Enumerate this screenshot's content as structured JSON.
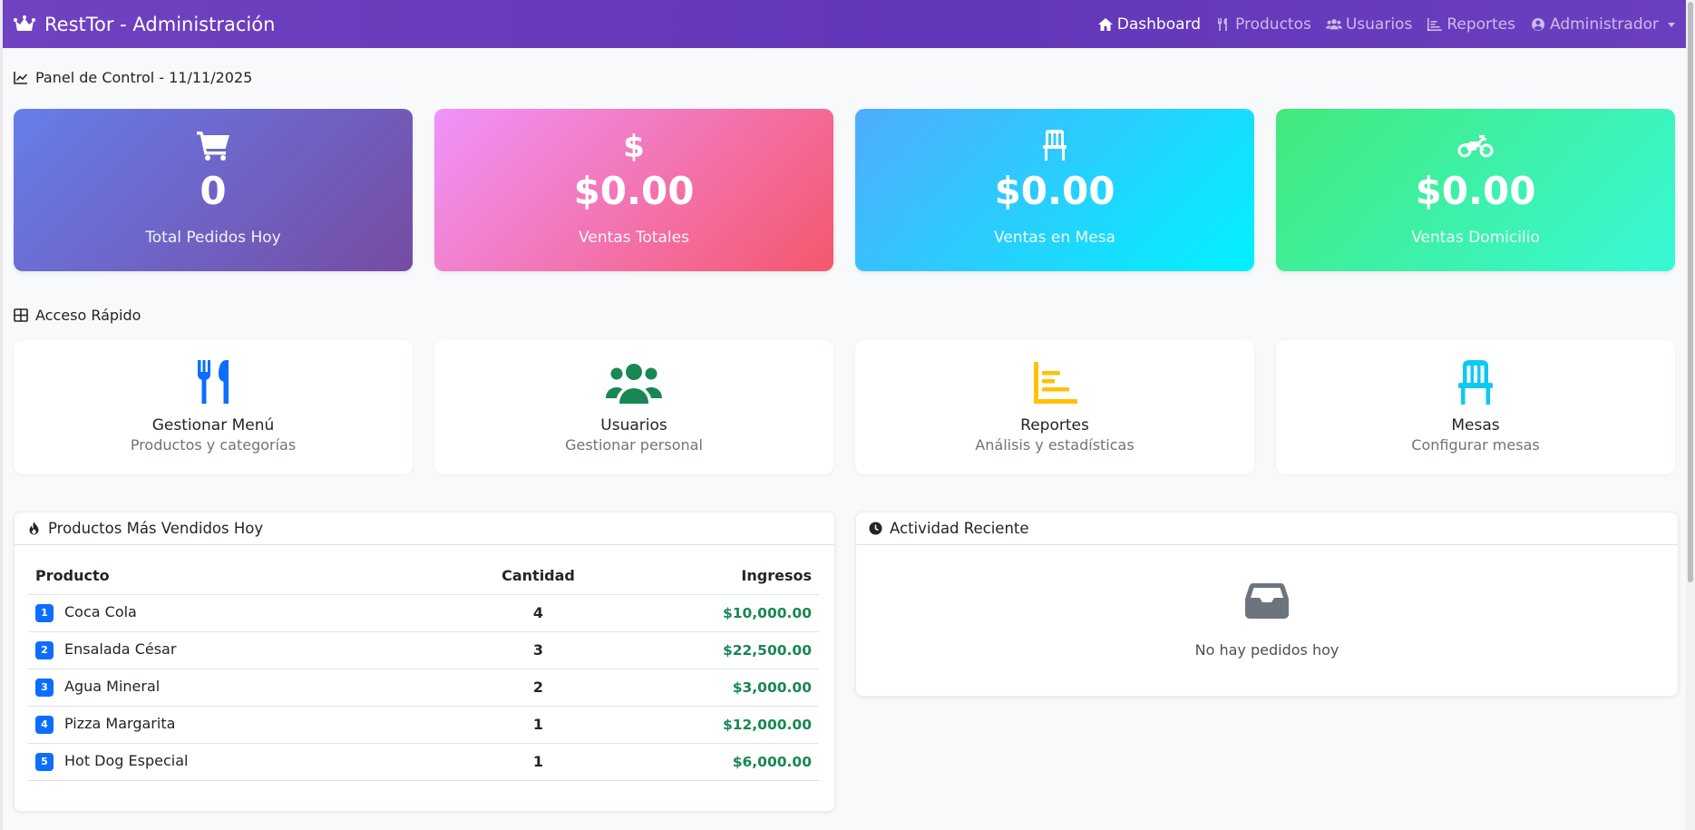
{
  "app": {
    "title": "RestTor - Administración"
  },
  "nav": {
    "dashboard": "Dashboard",
    "productos": "Productos",
    "usuarios": "Usuarios",
    "reportes": "Reportes",
    "admin": "Administrador"
  },
  "panel": {
    "title": "Panel de Control - 11/11/2025"
  },
  "stats": [
    {
      "value": "0",
      "label": "Total Pedidos Hoy",
      "icon": "cart-icon"
    },
    {
      "value": "$0.00",
      "label": "Ventas Totales",
      "icon": "dollar-icon"
    },
    {
      "value": "$0.00",
      "label": "Ventas en Mesa",
      "icon": "chair-icon"
    },
    {
      "value": "$0.00",
      "label": "Ventas Domicilio",
      "icon": "motorcycle-icon"
    }
  ],
  "quick": {
    "title": "Acceso Rápido",
    "items": [
      {
        "title": "Gestionar Menú",
        "subtitle": "Productos y categorías",
        "icon": "utensils-icon",
        "color": "#0d6efd"
      },
      {
        "title": "Usuarios",
        "subtitle": "Gestionar personal",
        "icon": "users-icon",
        "color": "#198754"
      },
      {
        "title": "Reportes",
        "subtitle": "Análisis y estadísticas",
        "icon": "chart-icon",
        "color": "#ffc107"
      },
      {
        "title": "Mesas",
        "subtitle": "Configurar mesas",
        "icon": "chair-icon",
        "color": "#0dcaf0"
      }
    ]
  },
  "top_products": {
    "title": "Productos Más Vendidos Hoy",
    "columns": [
      "Producto",
      "Cantidad",
      "Ingresos"
    ],
    "rows": [
      {
        "rank": "1",
        "name": "Coca Cola",
        "qty": "4",
        "income": "$10,000.00"
      },
      {
        "rank": "2",
        "name": "Ensalada César",
        "qty": "3",
        "income": "$22,500.00"
      },
      {
        "rank": "3",
        "name": "Agua Mineral",
        "qty": "2",
        "income": "$3,000.00"
      },
      {
        "rank": "4",
        "name": "Pizza Margarita",
        "qty": "1",
        "income": "$12,000.00"
      },
      {
        "rank": "5",
        "name": "Hot Dog Especial",
        "qty": "1",
        "income": "$6,000.00"
      }
    ]
  },
  "activity": {
    "title": "Actividad Reciente",
    "empty": "No hay pedidos hoy"
  }
}
